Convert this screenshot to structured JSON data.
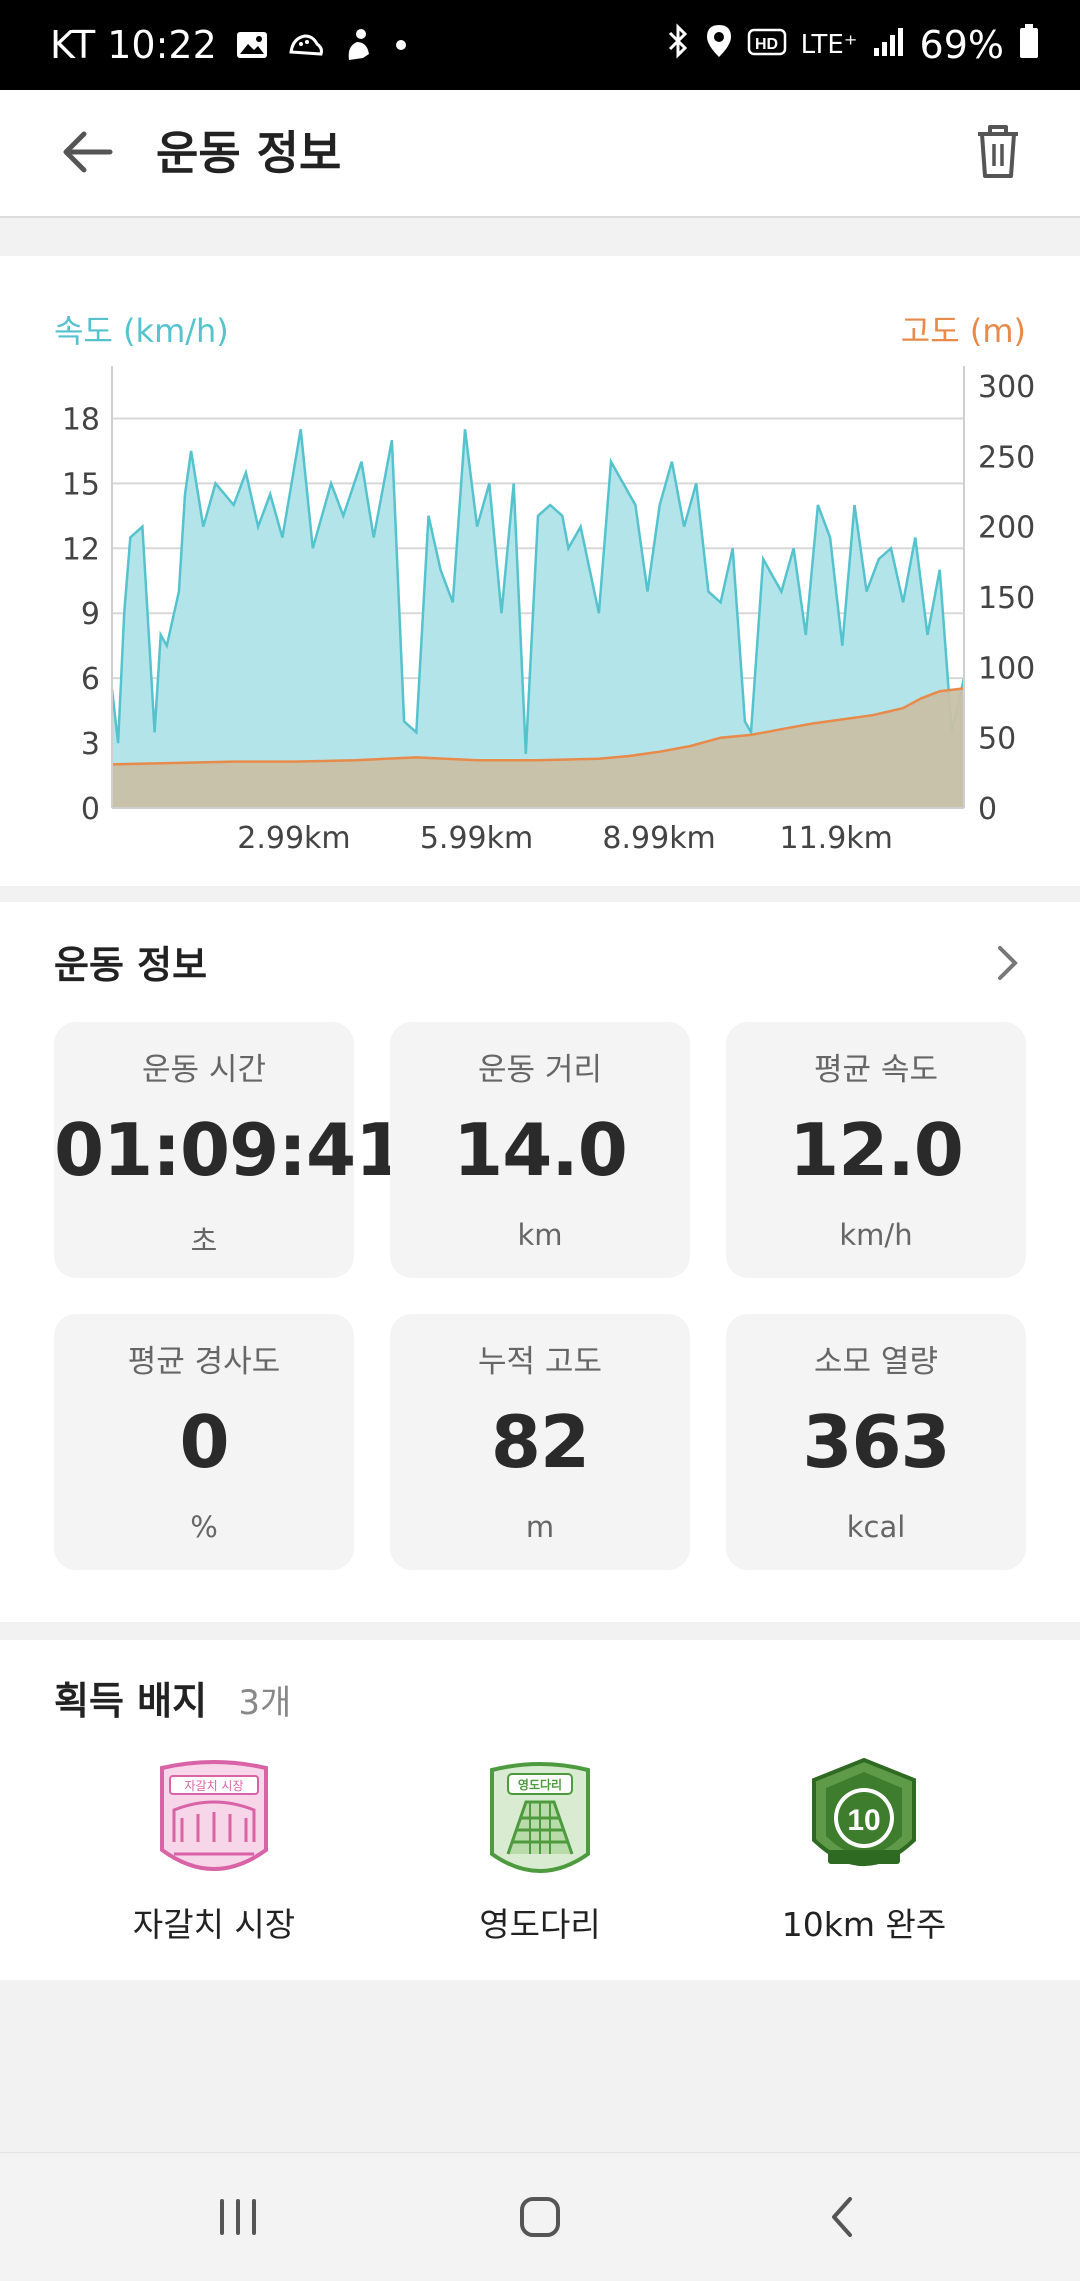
{
  "status_bar": {
    "carrier_time": "KT 10:22",
    "battery": "69%",
    "network": "LTE⁺"
  },
  "app_bar": {
    "title": "운동 정보"
  },
  "chart": {
    "speed_label": "속도 (km/h)",
    "altitude_label": "고도 (m)",
    "colors": {
      "speed": "#55c3cd",
      "speed_fill": "#b3e4ea",
      "altitude": "#e88a4a",
      "altitude_fill": "#c9c0a7"
    }
  },
  "chart_data": {
    "type": "area",
    "x_unit": "km",
    "xlim": [
      0,
      14.0
    ],
    "x_ticks": [
      "2.99km",
      "5.99km",
      "8.99km",
      "11.9km"
    ],
    "left_axis": {
      "label": "속도 (km/h)",
      "ticks": [
        "0",
        "3",
        "6",
        "9",
        "12",
        "15",
        "18"
      ],
      "ylim": [
        0,
        19.5
      ]
    },
    "right_axis": {
      "label": "고도 (m)",
      "ticks": [
        "0",
        "50",
        "100",
        "150",
        "200",
        "250",
        "300"
      ],
      "ylim": [
        0,
        300
      ]
    },
    "grid": true,
    "series": [
      {
        "name": "속도 (km/h)",
        "axis": "left",
        "x": [
          0,
          0.1,
          0.2,
          0.3,
          0.5,
          0.7,
          0.8,
          0.9,
          1.1,
          1.2,
          1.3,
          1.5,
          1.7,
          2.0,
          2.2,
          2.4,
          2.6,
          2.8,
          3.1,
          3.3,
          3.6,
          3.8,
          4.1,
          4.3,
          4.6,
          4.8,
          5.0,
          5.2,
          5.4,
          5.6,
          5.8,
          6.0,
          6.2,
          6.4,
          6.6,
          6.8,
          7.0,
          7.2,
          7.4,
          7.5,
          7.7,
          8.0,
          8.2,
          8.4,
          8.6,
          8.8,
          9.0,
          9.2,
          9.4,
          9.6,
          9.8,
          10.0,
          10.2,
          10.4,
          10.5,
          10.7,
          11.0,
          11.2,
          11.4,
          11.6,
          11.8,
          12.0,
          12.2,
          12.4,
          12.6,
          12.8,
          13.0,
          13.2,
          13.4,
          13.6,
          13.8,
          14.0
        ],
        "values": [
          5.5,
          3.0,
          9.0,
          12.5,
          13.0,
          3.5,
          8.0,
          7.5,
          10.0,
          14.5,
          16.5,
          13.0,
          15.0,
          14.0,
          15.5,
          13.0,
          14.5,
          12.5,
          17.5,
          12.0,
          15.0,
          13.5,
          16.0,
          12.5,
          17.0,
          4.0,
          3.5,
          13.5,
          11.0,
          9.5,
          17.5,
          13.0,
          15.0,
          9.0,
          15.0,
          2.5,
          13.5,
          14.0,
          13.5,
          12.0,
          13.0,
          9.0,
          16.0,
          15.0,
          14.0,
          10.0,
          14.0,
          16.0,
          13.0,
          15.0,
          10.0,
          9.5,
          12.0,
          4.0,
          3.5,
          11.5,
          10.0,
          12.0,
          8.0,
          14.0,
          12.5,
          7.5,
          14.0,
          10.0,
          11.5,
          12.0,
          9.5,
          12.5,
          8.0,
          11.0,
          3.5,
          6.0
        ]
      },
      {
        "name": "고도 (m)",
        "axis": "right",
        "x": [
          0,
          1.0,
          2.0,
          3.0,
          4.0,
          5.0,
          6.0,
          7.0,
          8.0,
          8.5,
          9.0,
          9.5,
          10.0,
          10.5,
          11.0,
          11.5,
          12.0,
          12.5,
          13.0,
          13.3,
          13.6,
          14.0
        ],
        "values": [
          31,
          32,
          33,
          33,
          34,
          36,
          34,
          34,
          35,
          37,
          40,
          44,
          50,
          52,
          56,
          60,
          63,
          66,
          71,
          78,
          83,
          85
        ]
      }
    ]
  },
  "info": {
    "title": "운동 정보",
    "stats": [
      {
        "label": "운동 시간",
        "value": "01:09:41",
        "unit": "초"
      },
      {
        "label": "운동 거리",
        "value": "14.0",
        "unit": "km"
      },
      {
        "label": "평균 속도",
        "value": "12.0",
        "unit": "km/h"
      },
      {
        "label": "평균 경사도",
        "value": "0",
        "unit": "%"
      },
      {
        "label": "누적 고도",
        "value": "82",
        "unit": "m"
      },
      {
        "label": "소모 열량",
        "value": "363",
        "unit": "kcal"
      }
    ]
  },
  "badges": {
    "title": "획득 배지",
    "count": "3개",
    "items": [
      {
        "name": "자갈치 시장",
        "emblem_text": "자갈치 시장",
        "color": "#d963a6",
        "icon": "market-badge-icon"
      },
      {
        "name": "영도다리",
        "emblem_text": "영도다리",
        "color": "#4e9a3e",
        "icon": "bridge-badge-icon"
      },
      {
        "name": "10km 완주",
        "emblem_text": "10",
        "color": "#3f7d2e",
        "icon": "finish-10km-badge-icon"
      }
    ]
  }
}
